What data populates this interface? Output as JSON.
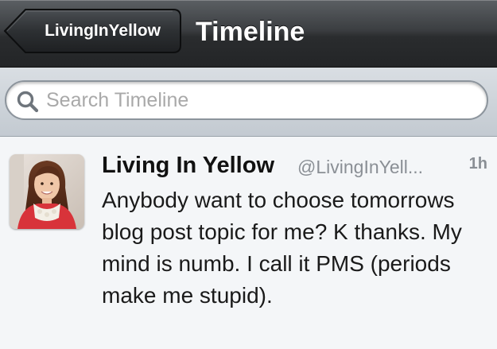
{
  "navbar": {
    "back_label": "LivingInYellow",
    "title": "Timeline"
  },
  "search": {
    "placeholder": "Search Timeline",
    "value": ""
  },
  "timeline": {
    "tweets": [
      {
        "name": "Living In Yellow",
        "handle": "@LivingInYell...",
        "time": "1h",
        "text": "Anybody want to choose tomorrows blog post topic for me? K thanks. My mind is numb. I call it PMS (periods make me stupid)."
      }
    ]
  },
  "colors": {
    "navbar_dark": "#2a2c2e",
    "searchbar_bg": "#c3cad1",
    "list_bg": "#f4f6f8",
    "handle_gray": "#8a8f95"
  },
  "icons": {
    "search": "search-icon",
    "back": "back-chevron-button"
  }
}
